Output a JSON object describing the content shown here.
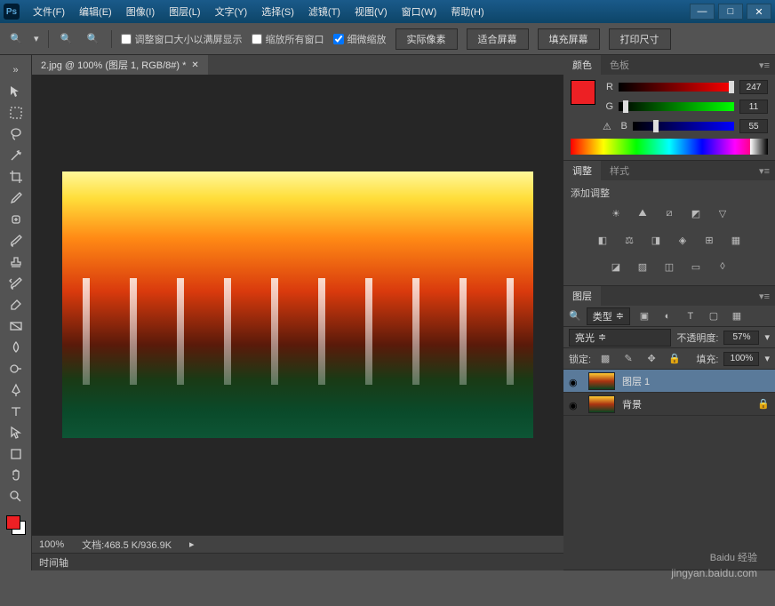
{
  "menu": [
    "文件(F)",
    "编辑(E)",
    "图像(I)",
    "图层(L)",
    "文字(Y)",
    "选择(S)",
    "滤镜(T)",
    "视图(V)",
    "窗口(W)",
    "帮助(H)"
  ],
  "optbar": {
    "resize_fit": "调整窗口大小以满屏显示",
    "zoom_all": "缩放所有窗口",
    "fine_zoom": "细微缩放",
    "actual": "实际像素",
    "fit": "适合屏幕",
    "fill": "填充屏幕",
    "print": "打印尺寸"
  },
  "doc": {
    "tab": "2.jpg @ 100% (图层 1, RGB/8#) *"
  },
  "status": {
    "zoom": "100%",
    "doc": "文档:468.5 K/936.9K"
  },
  "timeline": "时间轴",
  "color_panel": {
    "tabs": [
      "颜色",
      "色板"
    ],
    "r_label": "R",
    "r_val": "247",
    "g_label": "G",
    "g_val": "11",
    "b_label": "B",
    "b_val": "55"
  },
  "adjust_panel": {
    "tabs": [
      "调整",
      "样式"
    ],
    "title": "添加调整"
  },
  "layers_panel": {
    "tab": "图层",
    "kind": "类型",
    "blend": "亮光",
    "opacity_label": "不透明度:",
    "opacity_val": "57%",
    "lock_label": "锁定:",
    "fill_label": "填充:",
    "fill_val": "100%",
    "layers": [
      {
        "name": "图层 1",
        "selected": true
      },
      {
        "name": "背景",
        "locked": true
      }
    ]
  },
  "watermark": {
    "main": "Baidu 经验",
    "sub": "jingyan.baidu.com"
  }
}
